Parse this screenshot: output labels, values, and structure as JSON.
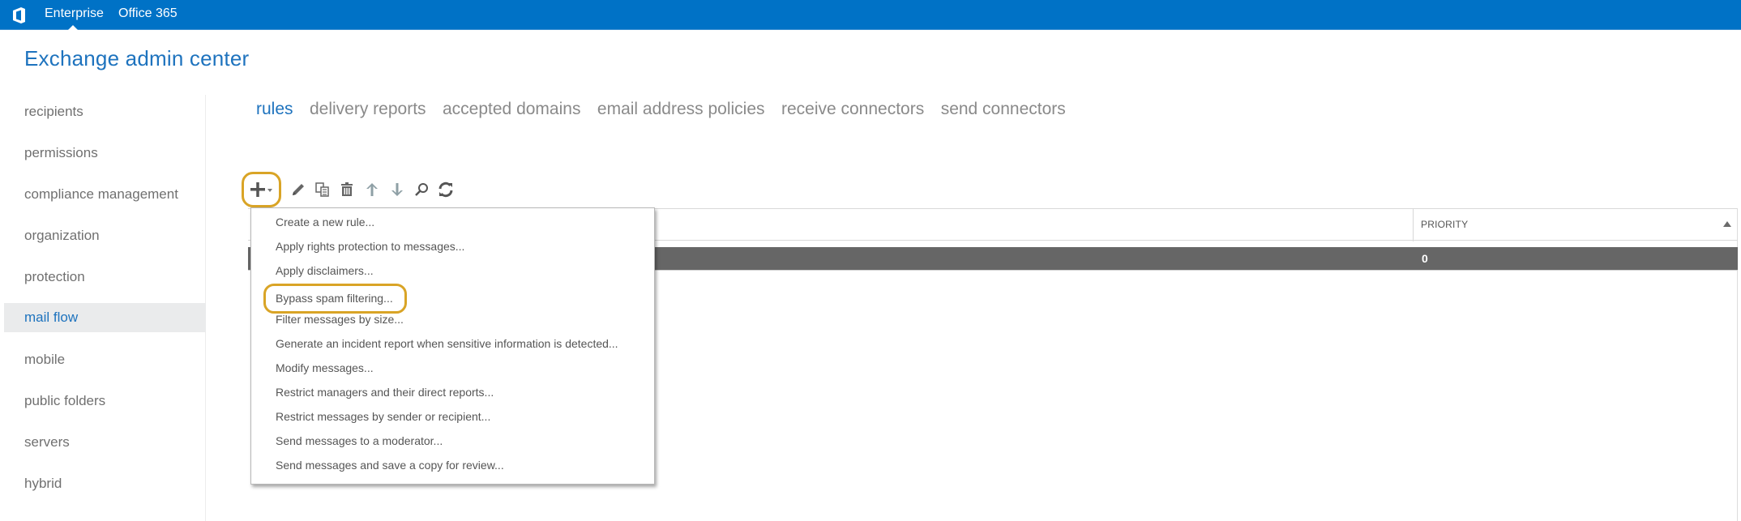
{
  "topbar": {
    "logo_icon": "office-logo-icon",
    "links": [
      "Enterprise",
      "Office 365"
    ],
    "active_link": "Enterprise",
    "color": "#0072c6"
  },
  "app": {
    "title": "Exchange admin center",
    "accent_color": "#1e73be"
  },
  "sidebar": {
    "items": [
      {
        "label": "recipients"
      },
      {
        "label": "permissions"
      },
      {
        "label": "compliance management"
      },
      {
        "label": "organization"
      },
      {
        "label": "protection"
      },
      {
        "label": "mail flow",
        "active": true
      },
      {
        "label": "mobile"
      },
      {
        "label": "public folders"
      },
      {
        "label": "servers"
      },
      {
        "label": "hybrid"
      }
    ]
  },
  "tabs": {
    "items": [
      {
        "label": "rules",
        "active": true
      },
      {
        "label": "delivery reports"
      },
      {
        "label": "accepted domains"
      },
      {
        "label": "email address policies"
      },
      {
        "label": "receive connectors"
      },
      {
        "label": "send connectors"
      }
    ]
  },
  "toolbar": {
    "buttons": [
      {
        "name": "add",
        "icon": "plus-icon",
        "has_dropdown": true,
        "highlighted": true
      },
      {
        "name": "edit",
        "icon": "pencil-icon"
      },
      {
        "name": "copy",
        "icon": "copy-icon"
      },
      {
        "name": "delete",
        "icon": "trash-icon"
      },
      {
        "name": "move-up",
        "icon": "arrow-up-icon"
      },
      {
        "name": "move-down",
        "icon": "arrow-down-icon"
      },
      {
        "name": "search",
        "icon": "search-icon"
      },
      {
        "name": "refresh",
        "icon": "refresh-icon"
      }
    ],
    "highlight_color": "#d9a426"
  },
  "grid": {
    "columns": [
      {
        "label": ""
      },
      {
        "label": "PRIORITY",
        "sorted": "ascending"
      }
    ],
    "rows": [
      {
        "name": "",
        "priority": "0",
        "selected": true
      }
    ]
  },
  "menu": {
    "items": [
      "Create a new rule...",
      "Apply rights protection to messages...",
      "Apply disclaimers...",
      "Bypass spam filtering...",
      "Filter messages by size...",
      "Generate an incident report when sensitive information is detected...",
      "Modify messages...",
      "Restrict managers and their direct reports...",
      "Restrict messages by sender or recipient...",
      "Send messages to a moderator...",
      "Send messages and save a copy for review..."
    ],
    "highlighted_item": "Bypass spam filtering..."
  }
}
